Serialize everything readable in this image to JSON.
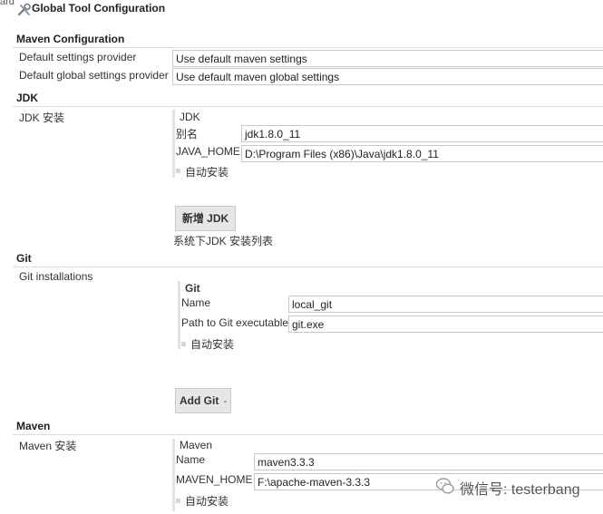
{
  "header": {
    "corner_text": "ard",
    "title": "Global Tool Configuration",
    "icon": "tools-icon"
  },
  "maven_config": {
    "heading": "Maven Configuration",
    "settings_label": "Default settings provider",
    "settings_value": "Use default maven settings",
    "global_label": "Default global settings provider",
    "global_value": "Use default maven global settings"
  },
  "jdk": {
    "heading": "JDK",
    "installs_label": "JDK 安装",
    "block_title": "JDK",
    "name_label": "别名",
    "name_value": "jdk1.8.0_11",
    "home_label": "JAVA_HOME",
    "home_value": "D:\\Program Files (x86)\\Java\\jdk1.8.0_11",
    "auto_install": "自动安装",
    "add_button": "新增 JDK",
    "list_caption": "系统下JDK 安装列表"
  },
  "git": {
    "heading": "Git",
    "installs_label": "Git installations",
    "block_title": "Git",
    "name_label": "Name",
    "name_value": "local_git",
    "path_label": "Path to Git executable",
    "path_value": "git.exe",
    "auto_install": "自动安装",
    "add_button": "Add Git",
    "add_button_caret": "-"
  },
  "maven": {
    "heading": "Maven",
    "installs_label": "Maven 安装",
    "block_title": "Maven",
    "name_label": "Name",
    "name_value": "maven3.3.3",
    "home_label": "MAVEN_HOME",
    "home_value": "F:\\apache-maven-3.3.3",
    "auto_install": "自动安装"
  },
  "watermark": {
    "text": "微信号: testerbang"
  }
}
